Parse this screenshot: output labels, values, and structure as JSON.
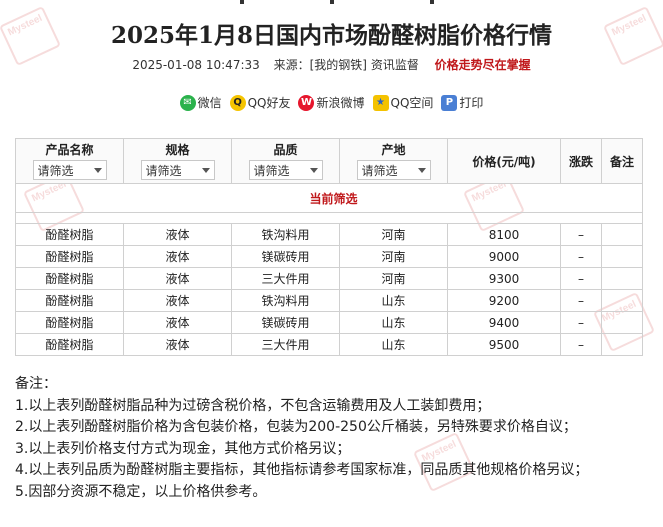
{
  "header": {
    "title": "2025年1月8日国内市场酚醛树脂价格行情",
    "datetime": "2025-01-08 10:47:33",
    "source_label": "来源：",
    "source": "[我的钢铁]",
    "source_tag": "资讯监督",
    "slogan": "价格走势尽在掌握"
  },
  "share": [
    {
      "label": "微信",
      "icon": "wechat-icon"
    },
    {
      "label": "QQ好友",
      "icon": "qq-icon"
    },
    {
      "label": "新浪微博",
      "icon": "weibo-icon"
    },
    {
      "label": "QQ空间",
      "icon": "qzone-icon"
    },
    {
      "label": "打印",
      "icon": "print-icon"
    }
  ],
  "table": {
    "headers": {
      "product": "产品名称",
      "spec": "规格",
      "quality": "品质",
      "origin": "产地",
      "price": "价格(元/吨)",
      "change": "涨跌",
      "remark": "备注"
    },
    "filter_placeholder": "请筛选",
    "current_filter": "当前筛选",
    "rows": [
      {
        "product": "酚醛树脂",
        "spec": "液体",
        "quality": "铁沟料用",
        "origin": "河南",
        "price": "8100",
        "change": "–",
        "remark": ""
      },
      {
        "product": "酚醛树脂",
        "spec": "液体",
        "quality": "镁碳砖用",
        "origin": "河南",
        "price": "9000",
        "change": "–",
        "remark": ""
      },
      {
        "product": "酚醛树脂",
        "spec": "液体",
        "quality": "三大件用",
        "origin": "河南",
        "price": "9300",
        "change": "–",
        "remark": ""
      },
      {
        "product": "酚醛树脂",
        "spec": "液体",
        "quality": "铁沟料用",
        "origin": "山东",
        "price": "9200",
        "change": "–",
        "remark": ""
      },
      {
        "product": "酚醛树脂",
        "spec": "液体",
        "quality": "镁碳砖用",
        "origin": "山东",
        "price": "9400",
        "change": "–",
        "remark": ""
      },
      {
        "product": "酚醛树脂",
        "spec": "液体",
        "quality": "三大件用",
        "origin": "山东",
        "price": "9500",
        "change": "–",
        "remark": ""
      }
    ]
  },
  "notes": {
    "title": "备注：",
    "items": [
      "1.以上表列酚醛树脂品种为过磅含税价格，不包含运输费用及人工装卸费用；",
      "2.以上表列酚醛树脂价格为含包装价格，包装为200-250公斤桶装，另特殊要求价格自议；",
      "3.以上表列价格支付方式为现金，其他方式价格另议；",
      "4.以上表列品质为酚醛树脂主要指标，其他指标请参考国家标准，同品质其他规格价格另议；",
      "5.因部分资源不稳定，以上价格供参考。"
    ]
  },
  "watermark": "Mysteel",
  "colors": {
    "slogan": "#c0181b",
    "border": "#d0d0d0"
  }
}
